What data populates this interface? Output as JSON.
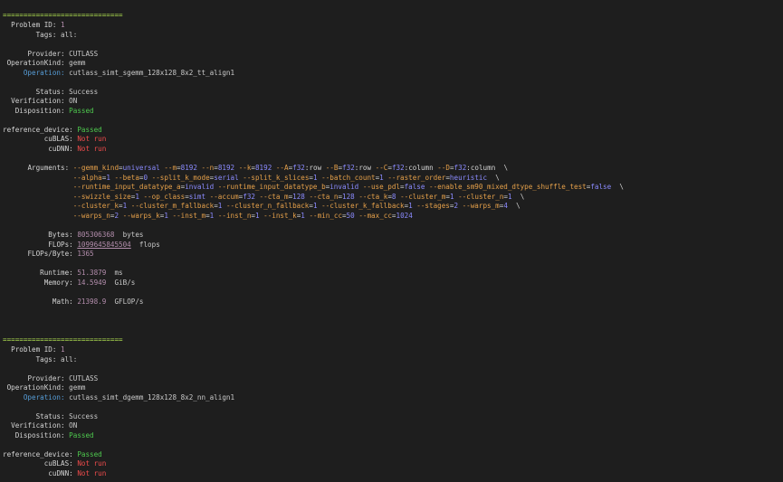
{
  "blocks": [
    {
      "separator": "=============================",
      "problem_id_label": "Problem ID:",
      "problem_id": "1",
      "tags_label": "Tags:",
      "tags": "all",
      "provider_label": "Provider:",
      "provider": "CUTLASS",
      "operation_kind_label": "OperationKind:",
      "operation_kind": "gemm",
      "operation_label": "Operation:",
      "operation": "cutlass_simt_sgemm_128x128_8x2_tt_align1",
      "status_label": "Status:",
      "status": "Success",
      "verification_label": "Verification:",
      "verification": "ON",
      "disposition_label": "Disposition:",
      "disposition": "Passed",
      "reference_device_label": "reference_device:",
      "reference_device": "Passed",
      "cublas_label": "cuBLAS:",
      "cublas": "Not run",
      "cudnn_label": "cuDNN:",
      "cudnn": "Not run"
    },
    {
      "separator": "=============================",
      "problem_id_label": "Problem ID:",
      "problem_id": "1",
      "tags_label": "Tags:",
      "tags": "all",
      "provider_label": "Provider:",
      "provider": "CUTLASS",
      "operation_kind_label": "OperationKind:",
      "operation_kind": "gemm",
      "operation_label": "Operation:",
      "operation": "cutlass_simt_dgemm_128x128_8x2_nn_align1",
      "status_label": "Status:",
      "status": "Success",
      "verification_label": "Verification:",
      "verification": "ON",
      "disposition_label": "Disposition:",
      "disposition": "Passed",
      "reference_device_label": "reference_device:",
      "reference_device": "Passed",
      "cublas_label": "cuBLAS:",
      "cublas": "Not run",
      "cudnn_label": "cuDNN:",
      "cudnn": "Not run"
    }
  ],
  "arguments_label": "Arguments:",
  "arguments": [
    [
      [
        "--gemm_kind",
        "universal"
      ],
      [
        "--m",
        "8192"
      ],
      [
        "--n",
        "8192"
      ],
      [
        "--k",
        "8192"
      ],
      [
        "--A",
        "f32:row"
      ],
      [
        "--B",
        "f32:row"
      ],
      [
        "--C",
        "f32:column"
      ],
      [
        "--D",
        "f32:column"
      ]
    ],
    [
      [
        "--alpha",
        "1"
      ],
      [
        "--beta",
        "0"
      ],
      [
        "--split_k_mode",
        "serial"
      ],
      [
        "--split_k_slices",
        "1"
      ],
      [
        "--batch_count",
        "1"
      ],
      [
        "--raster_order",
        "heuristic"
      ]
    ],
    [
      [
        "--runtime_input_datatype_a",
        "invalid"
      ],
      [
        "--runtime_input_datatype_b",
        "invalid"
      ],
      [
        "--use_pdl",
        "false"
      ],
      [
        "--enable_sm90_mixed_dtype_shuffle_test",
        "false"
      ]
    ],
    [
      [
        "--swizzle_size",
        "1"
      ],
      [
        "--op_class",
        "simt"
      ],
      [
        "--accum",
        "f32"
      ],
      [
        "--cta_m",
        "128"
      ],
      [
        "--cta_n",
        "128"
      ],
      [
        "--cta_k",
        "8"
      ],
      [
        "--cluster_m",
        "1"
      ],
      [
        "--cluster_n",
        "1"
      ]
    ],
    [
      [
        "--cluster_k",
        "1"
      ],
      [
        "--cluster_m_fallback",
        "1"
      ],
      [
        "--cluster_n_fallback",
        "1"
      ],
      [
        "--cluster_k_fallback",
        "1"
      ],
      [
        "--stages",
        "2"
      ],
      [
        "--warps_m",
        "4"
      ]
    ],
    [
      [
        "--warps_n",
        "2"
      ],
      [
        "--warps_k",
        "1"
      ],
      [
        "--inst_m",
        "1"
      ],
      [
        "--inst_n",
        "1"
      ],
      [
        "--inst_k",
        "1"
      ],
      [
        "--min_cc",
        "50"
      ],
      [
        "--max_cc",
        "1024"
      ]
    ]
  ],
  "line_continuation": "\\",
  "metrics": {
    "bytes_label": "Bytes:",
    "bytes": "805306368",
    "bytes_unit": "bytes",
    "flops_label": "FLOPs:",
    "flops": "1099645845504",
    "flops_unit": "flops",
    "flops_per_byte_label": "FLOPs/Byte:",
    "flops_per_byte": "1365",
    "runtime_label": "Runtime:",
    "runtime": "51.3879",
    "runtime_unit": "ms",
    "memory_label": "Memory:",
    "memory": "14.5949",
    "memory_unit": "GiB/s",
    "math_label": "Math:",
    "math": "21398.9",
    "math_unit": "GFLOP/s"
  }
}
